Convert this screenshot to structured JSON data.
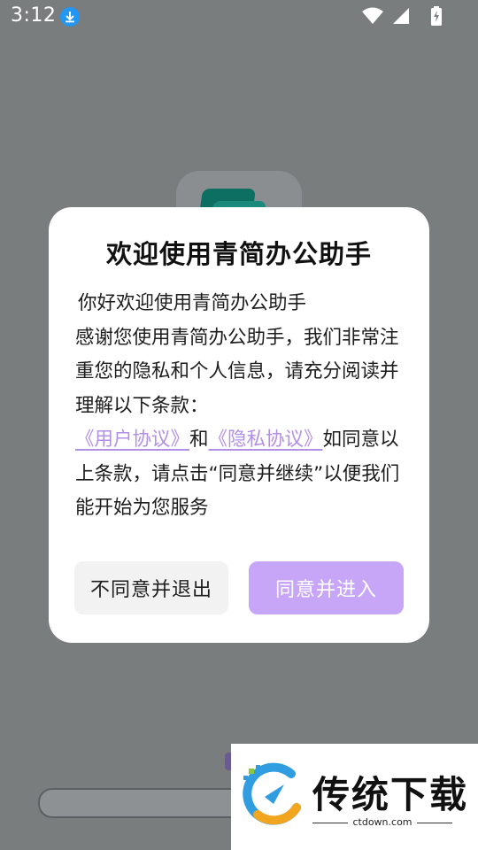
{
  "status_bar": {
    "time": "3:12",
    "icons": [
      "download-icon",
      "wifi-icon",
      "signal-icon",
      "battery-charging-icon"
    ]
  },
  "dialog": {
    "title": "欢迎使用青简办公助手",
    "greeting": "你好欢迎使用青简办公助手",
    "intro": "感谢您使用青简办公助手，我们非常注重您的隐私和个人信息，请充分阅读并理解以下条款：",
    "user_agreement_link": "《用户协议》",
    "conjunction": "和",
    "privacy_policy_link": "《隐私协议》",
    "outro": "如同意以上条款，请点击“同意并继续”以便我们能开始为您服务",
    "decline_button": "不同意并退出",
    "agree_button": "同意并进入"
  },
  "watermark": {
    "title": "传统下载",
    "subtitle": "ctdown.com"
  },
  "colors": {
    "accent": "#c7a6f7",
    "link": "#b290e6",
    "scrim": "#7a7d7e"
  }
}
